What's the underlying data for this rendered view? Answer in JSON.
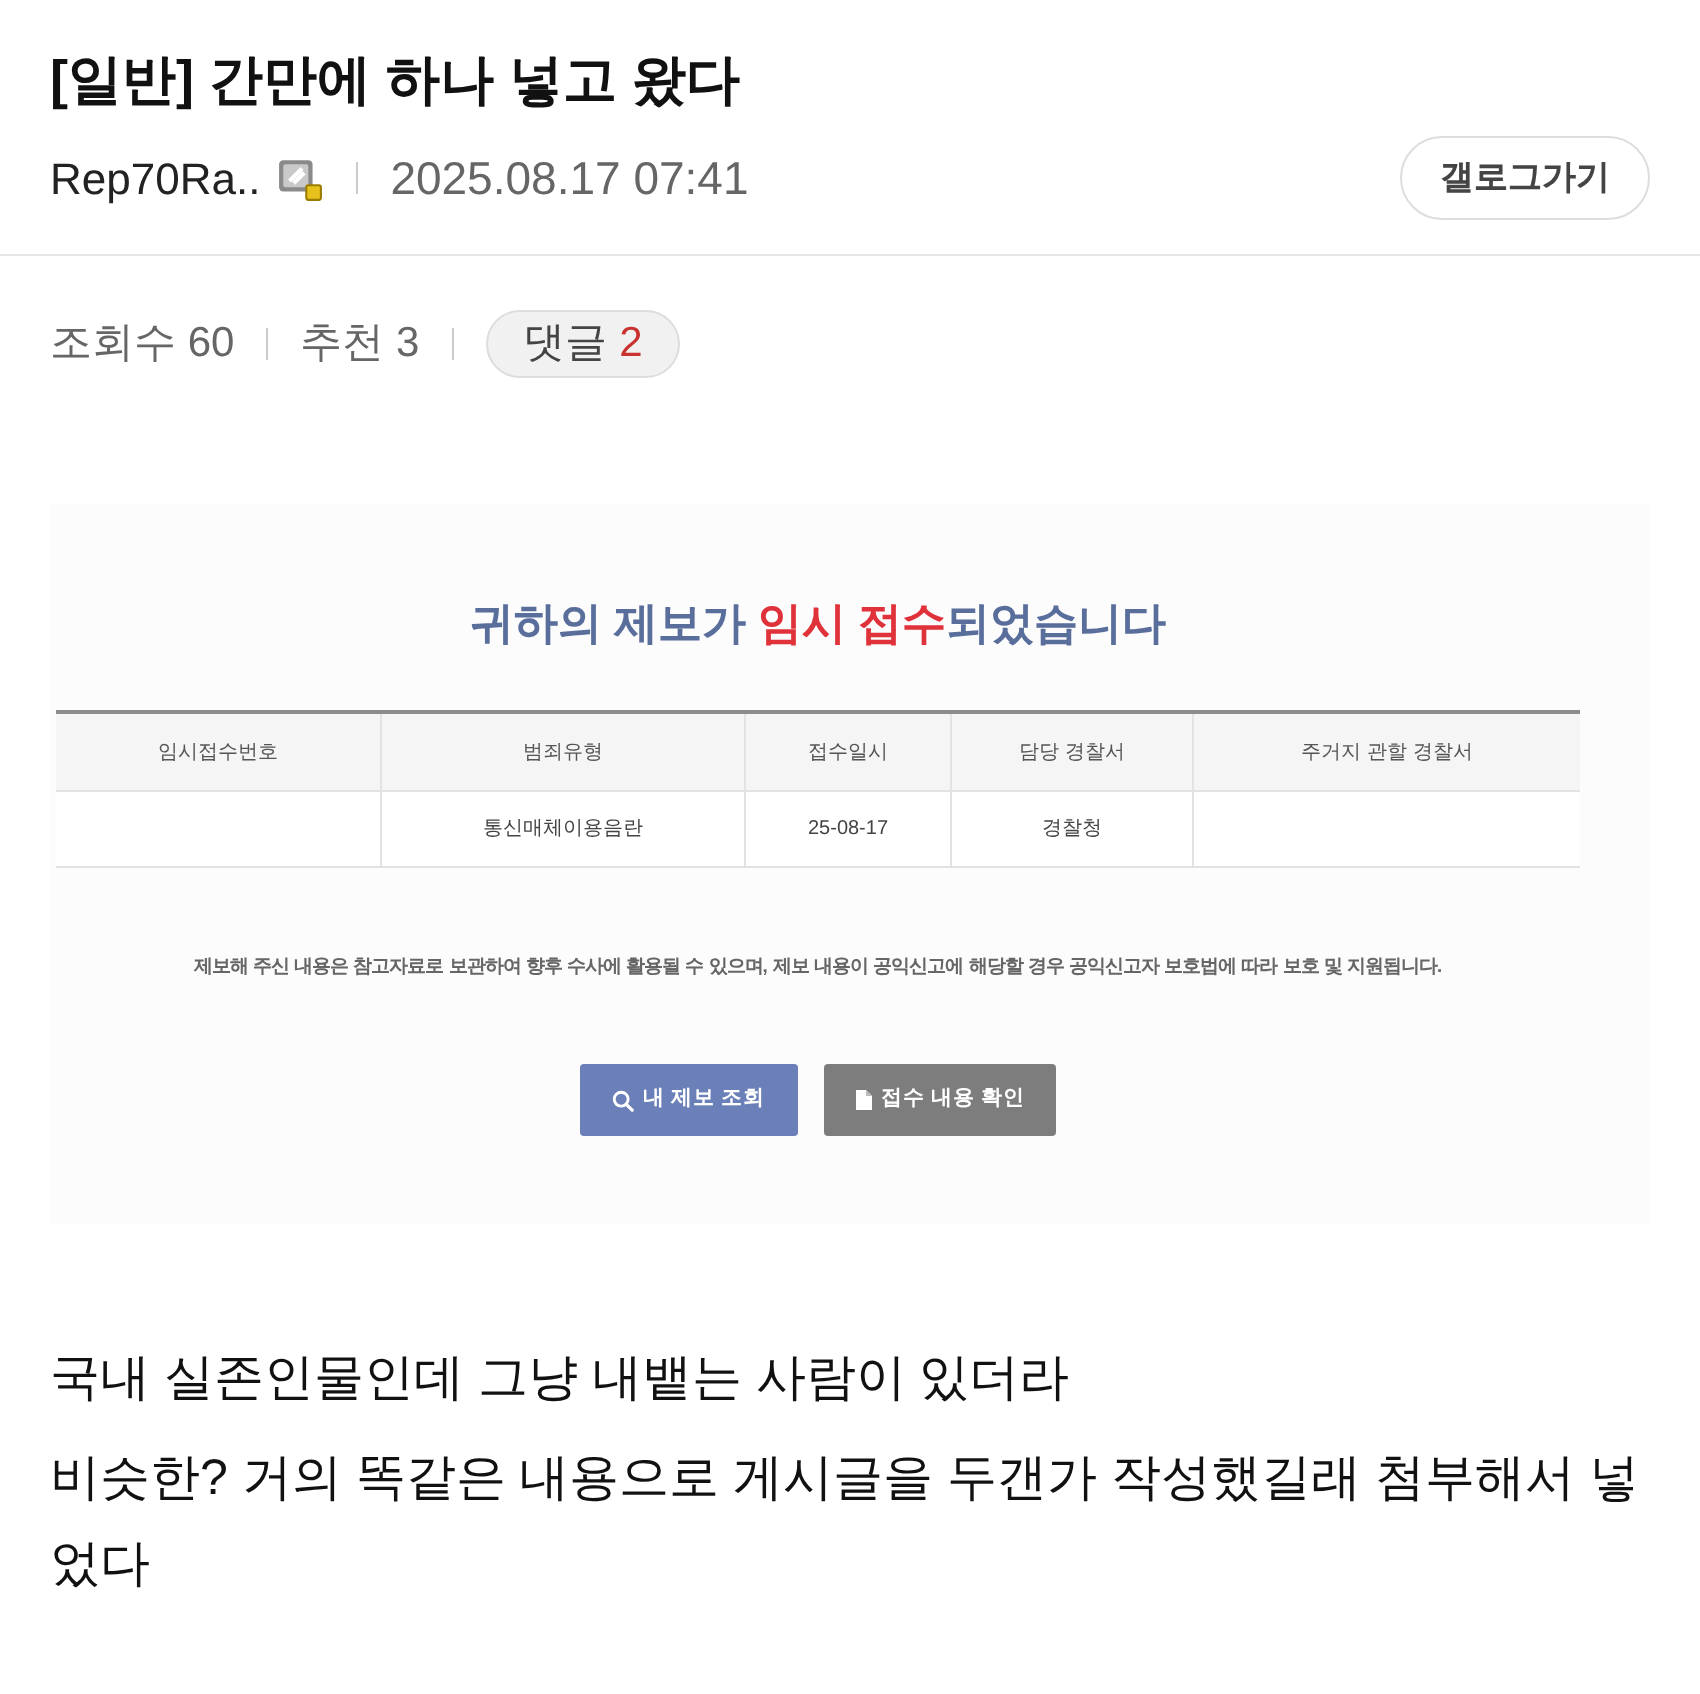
{
  "post": {
    "title": "[일반] 간만에 하나 넣고 왔다",
    "author": "Rep70Ra..",
    "date": "2025.08.17 07:41",
    "gallog_button": "갤로그가기"
  },
  "stats": [
    {
      "label": "조회수",
      "value": "60"
    },
    {
      "label": "추천",
      "value": "3"
    }
  ],
  "comments": {
    "label": "댓글",
    "count": "2"
  },
  "attachment": {
    "heading": [
      {
        "text": "귀하의 제보가 ",
        "highlight": false
      },
      {
        "text": "임시 접수",
        "highlight": true
      },
      {
        "text": "되었습니다",
        "highlight": false
      }
    ],
    "table": {
      "columns": [
        "임시접수번호",
        "범죄유형",
        "접수일시",
        "담당 경찰서",
        "주거지 관할 경찰서"
      ],
      "rows": [
        [
          null,
          "통신매체이용음란",
          "25-08-17",
          "경찰청",
          null
        ]
      ]
    },
    "notice": "제보해 주신 내용은 참고자료로 보관하여 향후 수사에 활용될 수 있으며, 제보 내용이 공익신고에 해당할 경우 공익신고자 보호법에 따라 보호 및 지원됩니다.",
    "buttons": [
      {
        "label": "내 제보 조회",
        "kind": "primary"
      },
      {
        "label": "접수 내용 확인",
        "kind": "secondary"
      }
    ]
  },
  "body": [
    "국내 실존인물인데 그냥 내뱉는 사람이 있더라",
    "비슷한? 거의 똑같은 내용으로 게시글을 두갠가 작성했길래 첨부해서 넣었다"
  ]
}
